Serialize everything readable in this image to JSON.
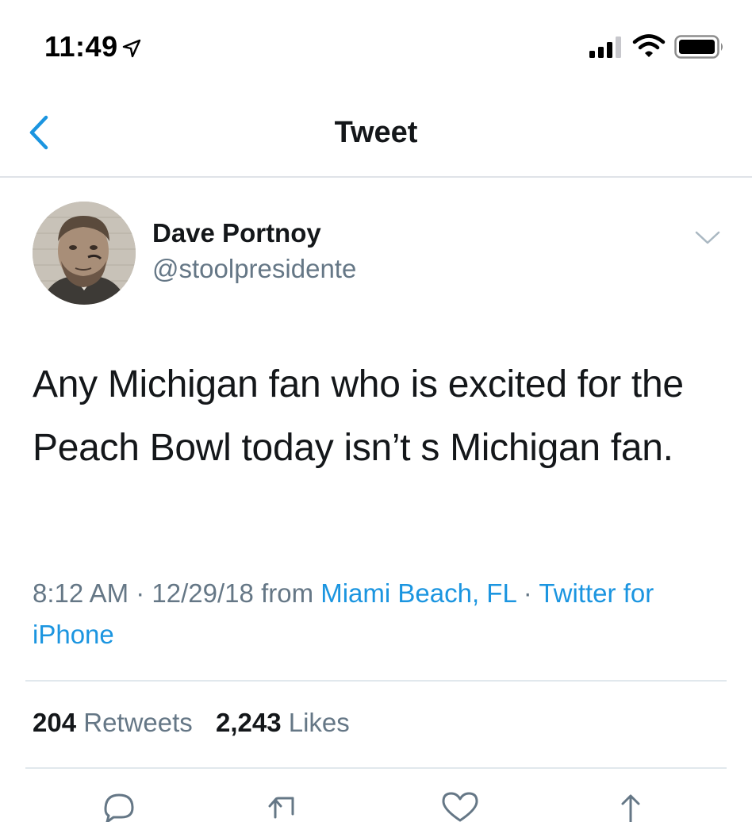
{
  "status_bar": {
    "time": "11:49",
    "icons": [
      "location-arrow-icon",
      "cellular-signal-icon",
      "wifi-icon",
      "battery-icon"
    ]
  },
  "nav": {
    "title": "Tweet",
    "back_icon": "chevron-left-icon"
  },
  "tweet": {
    "author_name": "Dave Portnoy",
    "author_handle": "@stoolpresidente",
    "text": "Any Michigan fan who is excited for the Peach Bowl today isn’t s Michigan fan.",
    "time": "8:12 AM",
    "date": "12/29/18",
    "from_label": "from",
    "location": "Miami Beach, FL",
    "source": "Twitter for iPhone",
    "separator": "·"
  },
  "stats": {
    "retweets_count": "204",
    "retweets_label": "Retweets",
    "likes_count": "2,243",
    "likes_label": "Likes"
  },
  "actions": [
    "reply-icon",
    "retweet-icon",
    "like-icon",
    "share-icon"
  ],
  "colors": {
    "link": "#1b95e0",
    "secondary_text": "#657786",
    "primary_text": "#14171a",
    "divider": "#e1e8ed"
  }
}
